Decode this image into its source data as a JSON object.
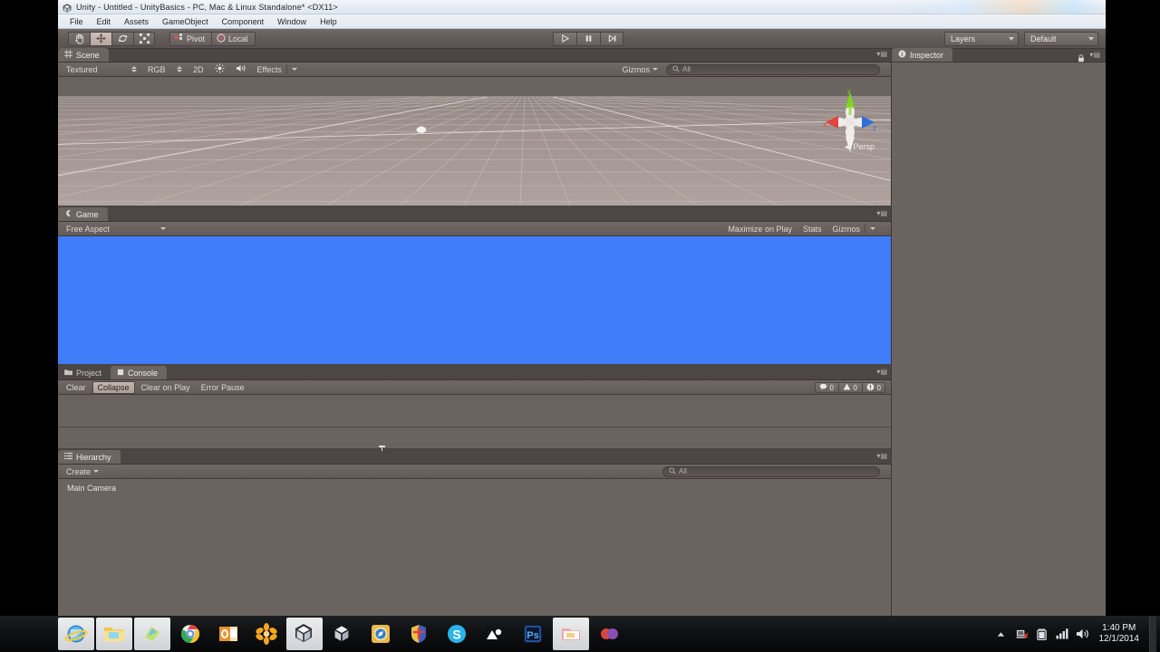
{
  "window": {
    "title": "Unity - Untitled - UnityBasics - PC, Mac & Linux Standalone* <DX11>",
    "icon": "unity-icon"
  },
  "menubar": {
    "items": [
      {
        "label": "File"
      },
      {
        "label": "Edit"
      },
      {
        "label": "Assets"
      },
      {
        "label": "GameObject"
      },
      {
        "label": "Component"
      },
      {
        "label": "Window"
      },
      {
        "label": "Help"
      }
    ]
  },
  "toolbar": {
    "tools": [
      {
        "name": "hand-tool",
        "icon": "hand-icon",
        "active": false
      },
      {
        "name": "move-tool",
        "icon": "move-icon",
        "active": true
      },
      {
        "name": "rotate-tool",
        "icon": "rotate-icon",
        "active": false
      },
      {
        "name": "scale-tool",
        "icon": "scale-icon",
        "active": false
      }
    ],
    "pivot_label": "Pivot",
    "local_label": "Local",
    "transport": [
      {
        "name": "play-button",
        "icon": "play-icon"
      },
      {
        "name": "pause-button",
        "icon": "pause-icon"
      },
      {
        "name": "step-button",
        "icon": "step-icon"
      }
    ],
    "layers_label": "Layers",
    "layout_label": "Default"
  },
  "scene_panel": {
    "tab_label": "Scene",
    "draw_mode": "Textured",
    "color_mode": "RGB",
    "mode_2d": "2D",
    "lighting_icon": "sun-icon",
    "audio_icon": "audio-icon",
    "effects_label": "Effects",
    "gizmos_label": "Gizmos",
    "search_placeholder": "All",
    "search_value": "",
    "persp_label": "Persp",
    "axis_x": "x",
    "axis_y": "y",
    "axis_z": "z"
  },
  "game_panel": {
    "tab_label": "Game",
    "aspect_label": "Free Aspect",
    "maximize_label": "Maximize on Play",
    "stats_label": "Stats",
    "gizmos_label": "Gizmos",
    "background_color": "#3f7dfb"
  },
  "console_panel": {
    "tabs": [
      {
        "label": "Project",
        "active": false
      },
      {
        "label": "Console",
        "active": true
      }
    ],
    "clear_label": "Clear",
    "collapse_label": "Collapse",
    "clear_on_play_label": "Clear on Play",
    "error_pause_label": "Error Pause",
    "counters": [
      {
        "name": "log-count",
        "icon": "message-icon",
        "value": "0"
      },
      {
        "name": "warning-count",
        "icon": "warning-icon",
        "value": "0"
      },
      {
        "name": "error-count",
        "icon": "error-icon",
        "value": "0"
      }
    ]
  },
  "hierarchy_panel": {
    "tab_label": "Hierarchy",
    "create_label": "Create",
    "search_placeholder": "All",
    "search_value": "",
    "items": [
      {
        "label": "Main Camera"
      }
    ]
  },
  "inspector_panel": {
    "tab_label": "Inspector",
    "lock_icon": "lock-icon"
  },
  "taskbar": {
    "apps": [
      {
        "name": "internet-explorer-icon",
        "lit": true
      },
      {
        "name": "file-explorer-icon",
        "lit": true
      },
      {
        "name": "media-player-icon",
        "lit": true
      },
      {
        "name": "chrome-icon",
        "lit": false
      },
      {
        "name": "outlook-icon",
        "lit": false
      },
      {
        "name": "flower-app-icon",
        "lit": false
      },
      {
        "name": "unity-light-icon",
        "lit": true
      },
      {
        "name": "unity-dark-icon",
        "lit": false
      },
      {
        "name": "compass-app-icon",
        "lit": false
      },
      {
        "name": "shield-app-icon",
        "lit": false
      },
      {
        "name": "skype-icon",
        "lit": false
      },
      {
        "name": "image-viewer-icon",
        "lit": false
      },
      {
        "name": "photoshop-icon",
        "lit": false
      },
      {
        "name": "folder-app-icon",
        "lit": true
      },
      {
        "name": "misc-app-icon",
        "lit": false
      }
    ],
    "tray": [
      {
        "name": "show-hidden-icons",
        "icon": "chevron-up-icon"
      },
      {
        "name": "network-icon",
        "icon": "network-error-icon"
      },
      {
        "name": "battery-icon",
        "icon": "battery-icon"
      },
      {
        "name": "signal-icon",
        "icon": "signal-bars-icon"
      },
      {
        "name": "volume-icon",
        "icon": "speaker-icon"
      }
    ],
    "clock_time": "1:40 PM",
    "clock_date": "12/1/2014"
  }
}
